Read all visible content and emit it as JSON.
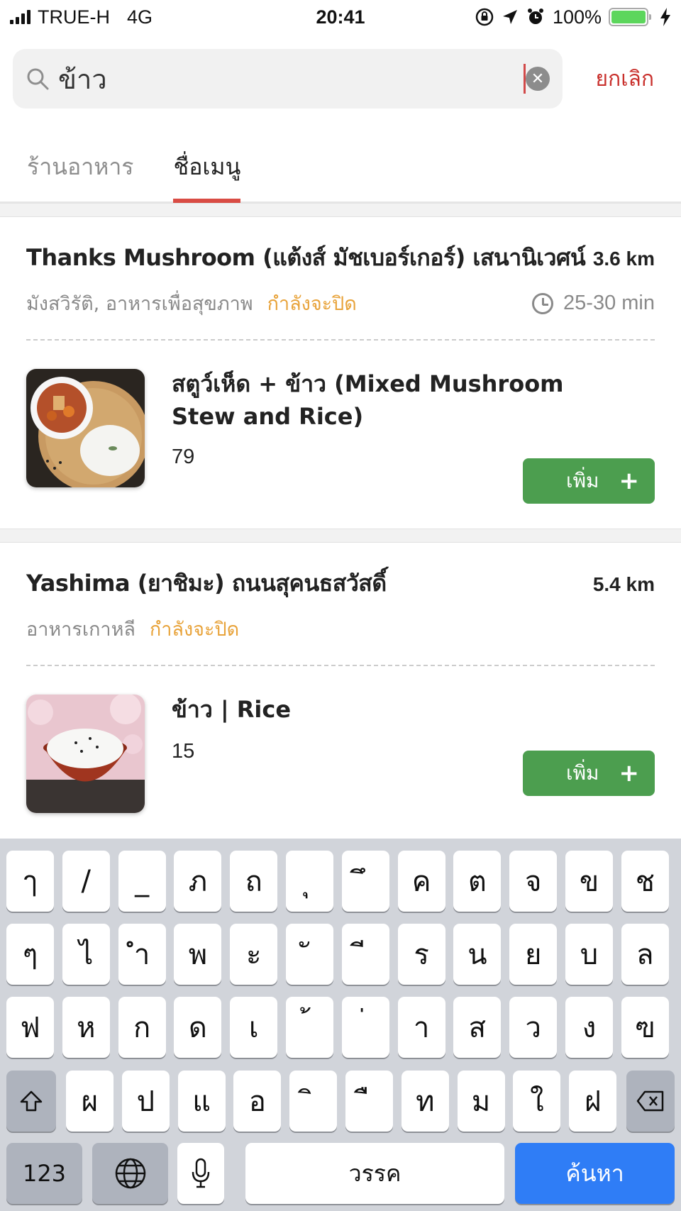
{
  "status_bar": {
    "carrier": "TRUE-H",
    "network": "4G",
    "time": "20:41",
    "battery": "100%"
  },
  "search": {
    "query": "ข้าว",
    "cancel_label": "ยกเลิก"
  },
  "tabs": [
    {
      "label": "ร้านอาหาร",
      "active": false
    },
    {
      "label": "ชื่อเมนู",
      "active": true
    }
  ],
  "results": [
    {
      "name": "Thanks Mushroom (แต้งส์ มัชเบอร์เกอร์) เสนานิเวศน์",
      "distance": "3.6 km",
      "categories": "มังสวิรัติ, อาหารเพื่อสุขภาพ",
      "status": "กำลังจะปิด",
      "time": "25-30 min",
      "item": {
        "name": "สตูว์เห็ด + ข้าว (Mixed Mushroom Stew and Rice)",
        "price": "79",
        "add_label": "เพิ่ม",
        "add_icon": "+"
      }
    },
    {
      "name": "Yashima (ยาชิมะ) ถนนสุคนธสวัสดิ์",
      "distance": "5.4 km",
      "categories": "อาหารเกาหลี",
      "status": "กำลังจะปิด",
      "item": {
        "name": "ข้าว | Rice",
        "price": "15",
        "add_label": "เพิ่ม",
        "add_icon": "+"
      }
    }
  ],
  "keyboard": {
    "row1": [
      "ๅ",
      "/",
      "_",
      "ภ",
      "ถ",
      "ุ",
      "ึ",
      "ค",
      "ต",
      "จ",
      "ข",
      "ช"
    ],
    "row2": [
      "ๆ",
      "ไ",
      "ำ",
      "พ",
      "ะ",
      "ั",
      "ี",
      "ร",
      "น",
      "ย",
      "บ",
      "ล"
    ],
    "row3": [
      "ฟ",
      "ห",
      "ก",
      "ด",
      "เ",
      "้",
      "่",
      "า",
      "ส",
      "ว",
      "ง",
      "ฃ"
    ],
    "row4": [
      "ผ",
      "ป",
      "แ",
      "อ",
      "ิ",
      "ื",
      "ท",
      "ม",
      "ใ",
      "ฝ"
    ],
    "numbers_label": "123",
    "space_label": "วรรค",
    "search_label": "ค้นหา"
  },
  "colors": {
    "accent": "#d94c44",
    "closing": "#e8a33a",
    "add_button": "#4c9e4f",
    "key_search": "#2f7df6"
  }
}
